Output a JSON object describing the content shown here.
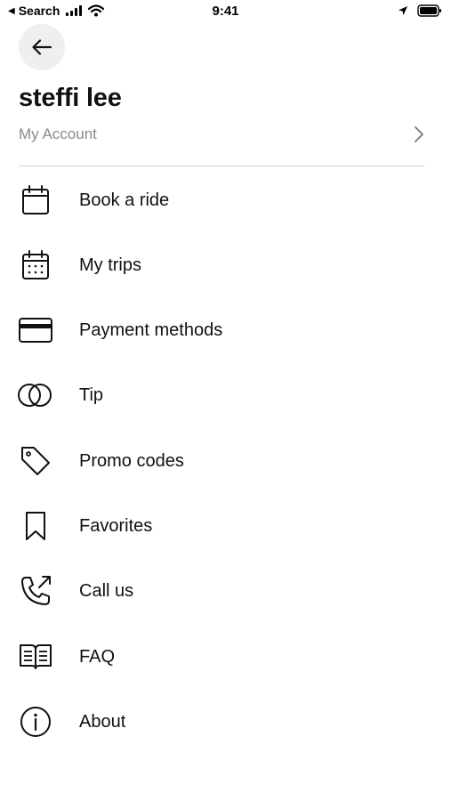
{
  "status_bar": {
    "back_label": "Search",
    "time": "9:41",
    "icons": [
      "back-triangle-icon",
      "signal-icon",
      "wifi-icon",
      "location-arrow-icon",
      "battery-icon"
    ]
  },
  "header": {
    "back_icon": "arrow-left-icon",
    "user_name": "steffi lee",
    "account_label": "My Account",
    "account_chevron_icon": "chevron-right-icon"
  },
  "menu": {
    "items": [
      {
        "label": "Book a ride",
        "icon": "calendar-icon"
      },
      {
        "label": "My trips",
        "icon": "calendar-dots-icon"
      },
      {
        "label": "Payment methods",
        "icon": "credit-card-icon"
      },
      {
        "label": "Tip",
        "icon": "tip-circles-icon"
      },
      {
        "label": "Promo codes",
        "icon": "tag-icon"
      },
      {
        "label": "Favorites",
        "icon": "bookmark-icon"
      },
      {
        "label": "Call us",
        "icon": "phone-outgoing-icon"
      },
      {
        "label": "FAQ",
        "icon": "book-open-icon"
      },
      {
        "label": "About",
        "icon": "info-circle-icon"
      }
    ]
  },
  "colors": {
    "text": "#111111",
    "secondary_text": "#8a8a8a",
    "back_button_bg": "#efefef",
    "divider": "#d5d5d5"
  }
}
